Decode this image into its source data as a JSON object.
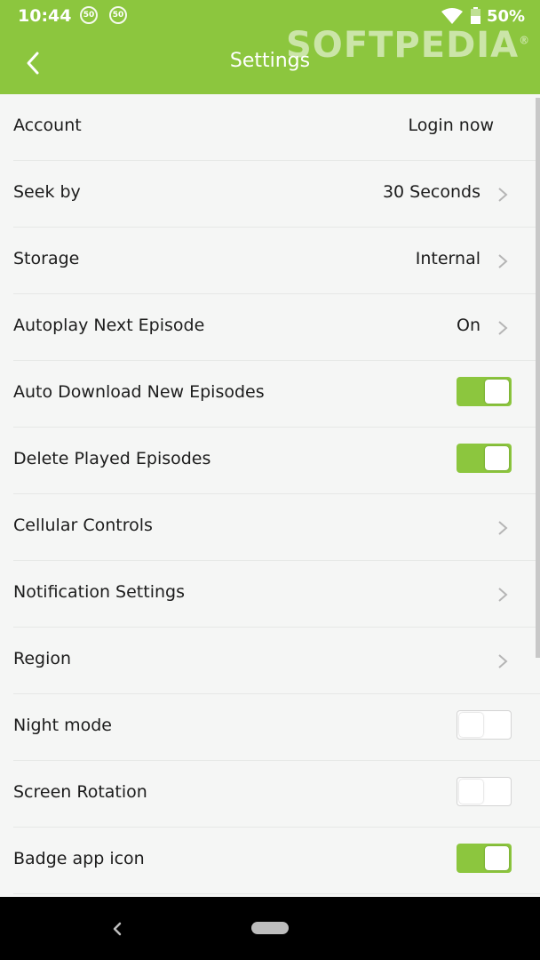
{
  "status_bar": {
    "time": "10:44",
    "notifications": [
      "50",
      "50"
    ],
    "battery": "50%"
  },
  "app_bar": {
    "title": "Settings",
    "watermark": "SOFTPEDIA"
  },
  "colors": {
    "accent": "#8cc63e",
    "background": "#f5f6f5"
  },
  "settings": [
    {
      "label": "Account",
      "value": "Login now",
      "control": "text"
    },
    {
      "label": "Seek by",
      "value": "30 Seconds",
      "control": "chevron"
    },
    {
      "label": "Storage",
      "value": "Internal",
      "control": "chevron"
    },
    {
      "label": "Autoplay Next Episode",
      "value": "On",
      "control": "chevron"
    },
    {
      "label": "Auto Download New Episodes",
      "control": "toggle",
      "on": true
    },
    {
      "label": "Delete Played Episodes",
      "control": "toggle",
      "on": true
    },
    {
      "label": "Cellular Controls",
      "control": "chevron"
    },
    {
      "label": "Notification Settings",
      "control": "chevron"
    },
    {
      "label": "Region",
      "control": "chevron"
    },
    {
      "label": "Night mode",
      "control": "toggle",
      "on": false
    },
    {
      "label": "Screen Rotation",
      "control": "toggle",
      "on": false
    },
    {
      "label": "Badge app icon",
      "control": "toggle",
      "on": true
    }
  ]
}
